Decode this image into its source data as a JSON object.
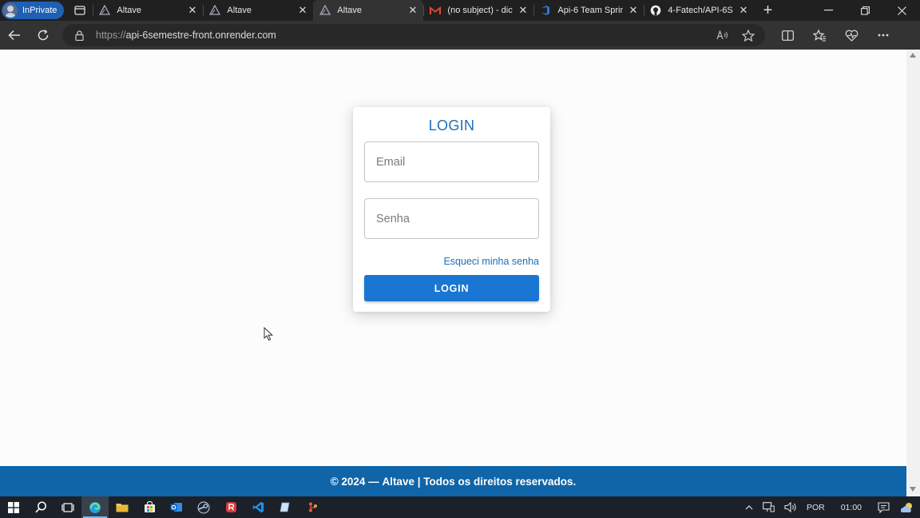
{
  "browser": {
    "inprivate_label": "InPrivate",
    "tabs": [
      {
        "title": "Altave",
        "close": "✕",
        "active": false
      },
      {
        "title": "Altave",
        "close": "✕",
        "active": false
      },
      {
        "title": "Altave",
        "close": "✕",
        "active": true
      },
      {
        "title": "(no subject) - dic",
        "close": "✕",
        "active": false
      },
      {
        "title": "Api-6 Team Sprin",
        "close": "✕",
        "active": false
      },
      {
        "title": "4-Fatech/API-6S",
        "close": "✕",
        "active": false
      }
    ],
    "new_tab_label": "+",
    "url_protocol": "https://",
    "url_host": "api-6semestre-front.onrender.com"
  },
  "login": {
    "title": "LOGIN",
    "email_placeholder": "Email",
    "password_placeholder": "Senha",
    "forgot_password": "Esqueci minha senha",
    "submit_label": "LOGIN"
  },
  "footer": {
    "prefix": "© 2024 — ",
    "brand_text": "Altave | Todos os direitos reservados."
  },
  "taskbar": {
    "language": "POR",
    "time": "01:00"
  },
  "colors": {
    "brand_blue": "#1e6fb6",
    "button_blue": "#1976d2",
    "footer_blue": "#0f65a8"
  }
}
